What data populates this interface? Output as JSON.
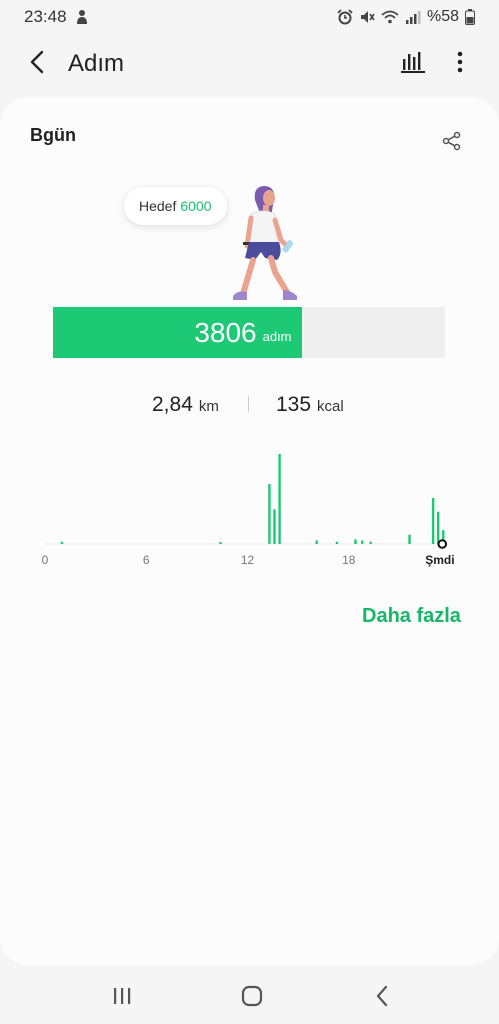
{
  "status_bar": {
    "time": "23:48",
    "battery": "%58",
    "icons": [
      "person-notification-icon",
      "alarm-icon",
      "mute-icon",
      "wifi-icon",
      "signal-icon",
      "battery-icon"
    ]
  },
  "app_bar": {
    "title": "Adım",
    "icons": [
      "back-arrow-icon",
      "bar-chart-icon",
      "more-vert-icon"
    ]
  },
  "card": {
    "date_label": "Bgün",
    "goal_label": "Hedef",
    "goal_value": "6000",
    "steps": "3806",
    "steps_unit": "adım",
    "progress_fraction": 0.634,
    "distance_value": "2,84",
    "distance_unit": "km",
    "calories_value": "135",
    "calories_unit": "kcal",
    "more_link": "Daha fazla"
  },
  "colors": {
    "accent_green": "#1dc974",
    "link_green": "#17b66a",
    "card_bg": "#fcfcfc",
    "page_bg": "#f5f5f5"
  },
  "chart_data": {
    "type": "bar",
    "x_tick_labels": [
      "0",
      "6",
      "12",
      "18",
      "Şmdi"
    ],
    "x_range_hours": [
      0,
      24
    ],
    "hours": [
      1.0,
      10.4,
      13.3,
      13.6,
      13.9,
      16.1,
      17.3,
      18.4,
      18.8,
      19.3,
      21.6,
      23.0,
      23.3,
      23.6
    ],
    "values": [
      2,
      1,
      52,
      30,
      78,
      3,
      2,
      4,
      3,
      2,
      8,
      40,
      28,
      12
    ],
    "current_marker_hour": 23.6
  },
  "nav_bar": {
    "icons": [
      "recent-apps-icon",
      "home-icon",
      "back-icon"
    ]
  }
}
